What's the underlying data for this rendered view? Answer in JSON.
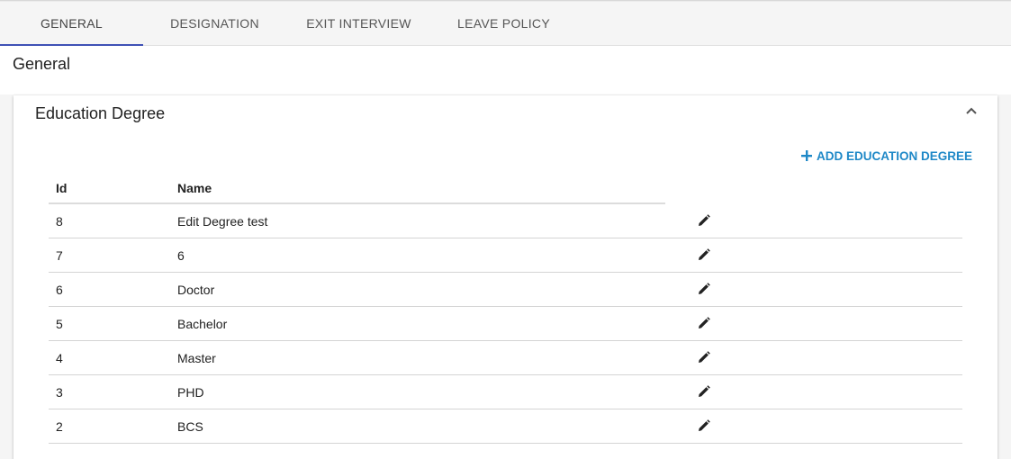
{
  "tabs": [
    {
      "label": "GENERAL",
      "active": true
    },
    {
      "label": "DESIGNATION",
      "active": false
    },
    {
      "label": "EXIT INTERVIEW",
      "active": false
    },
    {
      "label": "LEAVE POLICY",
      "active": false
    }
  ],
  "page": {
    "title": "General"
  },
  "panel": {
    "title": "Education Degree",
    "collapse_icon": "chevron-up-icon",
    "add_button_label": "ADD EDUCATION DEGREE",
    "add_button_icon": "plus-icon"
  },
  "table": {
    "headers": {
      "id": "Id",
      "name": "Name"
    },
    "rows": [
      {
        "id": "8",
        "name": "Edit Degree test"
      },
      {
        "id": "7",
        "name": "6"
      },
      {
        "id": "6",
        "name": "Doctor"
      },
      {
        "id": "5",
        "name": "Bachelor"
      },
      {
        "id": "4",
        "name": "Master"
      },
      {
        "id": "3",
        "name": "PHD"
      },
      {
        "id": "2",
        "name": "BCS"
      }
    ],
    "row_action_icon": "pencil-icon"
  },
  "colors": {
    "accent": "#3f51b5",
    "link": "#1e88c7"
  }
}
